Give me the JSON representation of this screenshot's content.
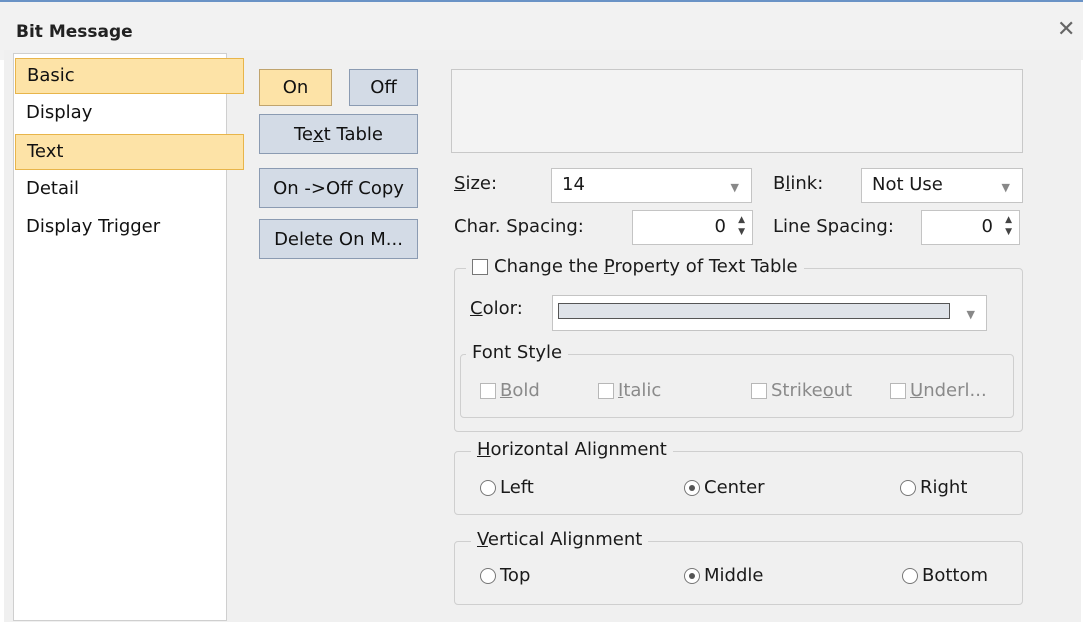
{
  "window": {
    "title": "Bit Message",
    "close_glyph": "✕"
  },
  "sidebar": {
    "items": [
      {
        "label": "Basic",
        "selected": true
      },
      {
        "label": "Display",
        "selected": false
      },
      {
        "label": "Text",
        "selected": true
      },
      {
        "label": "Detail",
        "selected": false
      },
      {
        "label": "Display Trigger",
        "selected": false
      }
    ]
  },
  "buttons": {
    "on": "On",
    "off": "Off",
    "text_table_pre": "Te",
    "text_table_u": "x",
    "text_table_post": "t Table",
    "copy": "On ->Off Copy",
    "delete": "Delete On M..."
  },
  "size": {
    "label_u": "S",
    "label_rest": "ize:",
    "value": "14"
  },
  "blink": {
    "label_pre": "B",
    "label_u": "l",
    "label_rest": "ink:",
    "value": "Not Use"
  },
  "char_spacing": {
    "label": "Char. Spacing:",
    "value": "0"
  },
  "line_spacing": {
    "label": "Line Spacing:",
    "value": "0"
  },
  "text_table_property": {
    "pre": "Change the ",
    "u": "P",
    "post": "roperty of Text Table",
    "checked": false,
    "color_label_u": "C",
    "color_label_rest": "olor:",
    "color_value": "#dfe3e9",
    "font_style": {
      "legend": "Font Style",
      "bold_u": "B",
      "bold_rest": "old",
      "italic_u": "I",
      "italic_rest": "talic",
      "strike_pre": "Strike",
      "strike_u": "o",
      "strike_rest": "ut",
      "underline_u": "U",
      "underline_rest": "nderl..."
    }
  },
  "horizontal_alignment": {
    "legend_u": "H",
    "legend_rest": "orizontal Alignment",
    "options": [
      "Left",
      "Center",
      "Right"
    ],
    "selected": "Center"
  },
  "vertical_alignment": {
    "legend_u": "V",
    "legend_rest": "ertical Alignment",
    "options": [
      "Top",
      "Middle",
      "Bottom"
    ],
    "selected": "Middle"
  },
  "icons": {
    "dropdown": "▼",
    "spin_up": "▲",
    "spin_down": "▼"
  }
}
